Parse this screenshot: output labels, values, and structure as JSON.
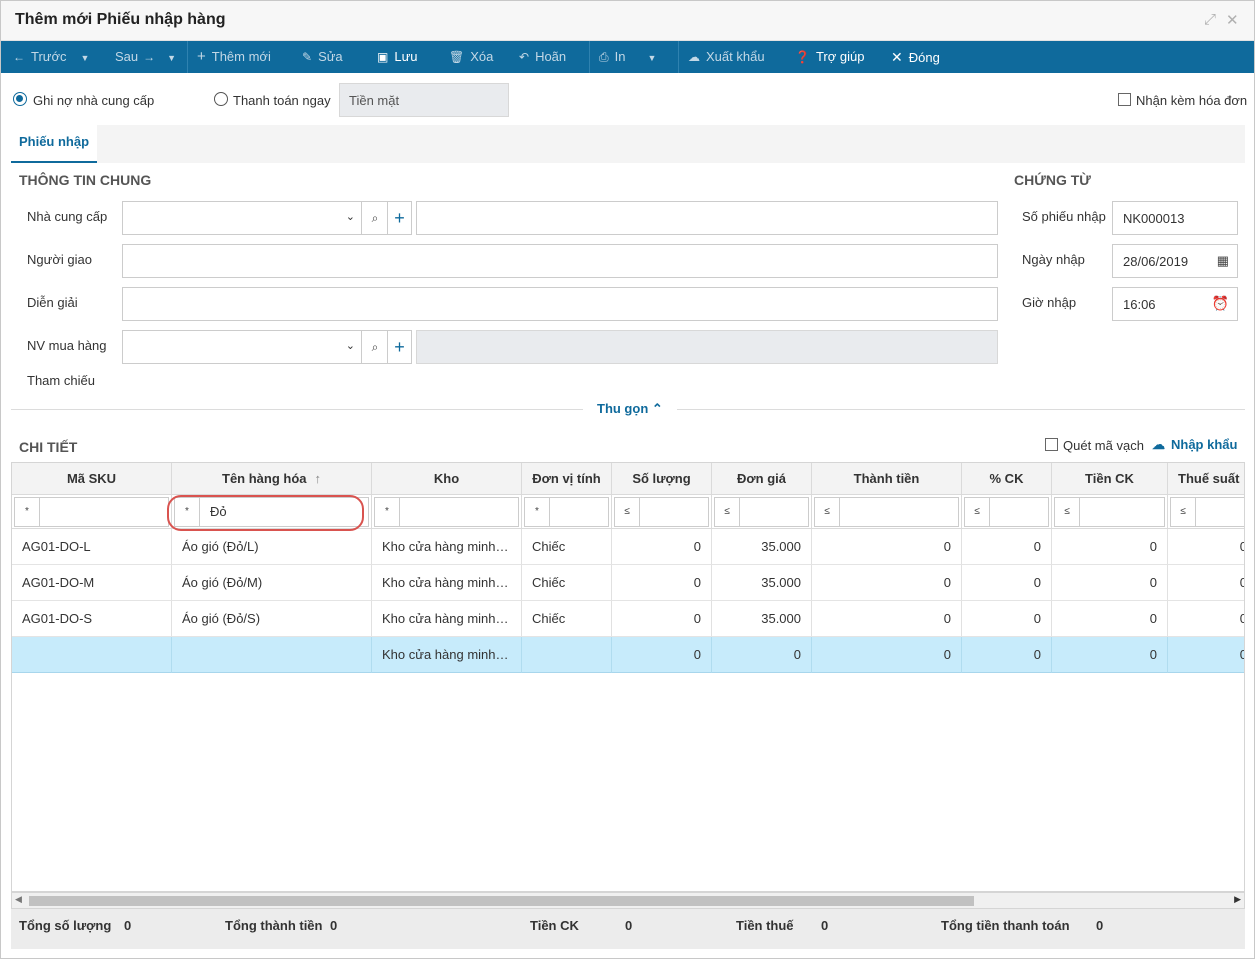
{
  "window": {
    "title": "Thêm mới Phiếu nhập hàng",
    "controls": [
      "⤢",
      "✕"
    ]
  },
  "toolbar": {
    "prev": "Trước",
    "next": "Sau",
    "add": "Thêm mới",
    "edit": "Sửa",
    "save": "Lưu",
    "delete": "Xóa",
    "undo": "Hoãn",
    "print": "In",
    "export": "Xuất khẩu",
    "help": "Trợ giúp",
    "close": "Đóng"
  },
  "payment": {
    "option_debt": "Ghi nợ nhà cung cấp",
    "option_pay_now": "Thanh toán ngay",
    "method": "Tiền mặt",
    "with_invoice": "Nhận kèm hóa đơn"
  },
  "tabs": [
    "Phiếu nhập"
  ],
  "general": {
    "title": "THÔNG TIN CHUNG",
    "supplier_label": "Nhà cung cấp",
    "deliverer_label": "Người giao",
    "description_label": "Diễn giải",
    "buyer_label": "NV mua hàng",
    "reference_label": "Tham chiếu"
  },
  "voucher": {
    "title": "CHỨNG TỪ",
    "number_label": "Số phiếu nhập",
    "number": "NK000013",
    "date_label": "Ngày nhập",
    "date": "28/06/2019",
    "time_label": "Giờ nhập",
    "time": "16:06"
  },
  "collapse_label": "Thu gọn ⌃",
  "detail": {
    "title": "CHI TIẾT",
    "scan_barcode": "Quét mã vạch",
    "import": "Nhập khẩu"
  },
  "grid": {
    "columns": [
      "Mã SKU",
      "Tên hàng hóa",
      "Kho",
      "Đơn vị tính",
      "Số lượng",
      "Đơn giá",
      "Thành tiền",
      "% CK",
      "Tiền CK",
      "Thuế suất"
    ],
    "sort_indicator": "↑",
    "filters": [
      {
        "op": "*",
        "value": ""
      },
      {
        "op": "*",
        "value": "Đỏ"
      },
      {
        "op": "*",
        "value": ""
      },
      {
        "op": "*",
        "value": ""
      },
      {
        "op": "≤",
        "value": ""
      },
      {
        "op": "≤",
        "value": ""
      },
      {
        "op": "≤",
        "value": ""
      },
      {
        "op": "≤",
        "value": ""
      },
      {
        "op": "≤",
        "value": ""
      },
      {
        "op": "≤",
        "value": ""
      }
    ],
    "rows": [
      [
        "AG01-DO-L",
        "Áo gió (Đỏ/L)",
        "Kho cửa hàng minhanh",
        "Chiếc",
        "0",
        "35.000",
        "0",
        "0",
        "0",
        "0"
      ],
      [
        "AG01-DO-M",
        "Áo gió (Đỏ/M)",
        "Kho cửa hàng minhanh",
        "Chiếc",
        "0",
        "35.000",
        "0",
        "0",
        "0",
        "0"
      ],
      [
        "AG01-DO-S",
        "Áo gió (Đỏ/S)",
        "Kho cửa hàng minhanh",
        "Chiếc",
        "0",
        "35.000",
        "0",
        "0",
        "0",
        "0"
      ],
      [
        "",
        "",
        "Kho cửa hàng minhanh",
        "",
        "0",
        "0",
        "0",
        "0",
        "0",
        "0"
      ]
    ],
    "selected_row": 3
  },
  "totals": {
    "qty_label": "Tổng số lượng",
    "qty": "0",
    "amount_label": "Tổng thành tiền",
    "amount": "0",
    "discount_label": "Tiền CK",
    "discount": "0",
    "tax_label": "Tiền thuế",
    "tax": "0",
    "payment_label": "Tổng tiền thanh toán",
    "payment": "0"
  },
  "colors": {
    "primary": "#0f6a9c",
    "selected_row": "#c7ebfb",
    "annotation": "#d9534f"
  }
}
